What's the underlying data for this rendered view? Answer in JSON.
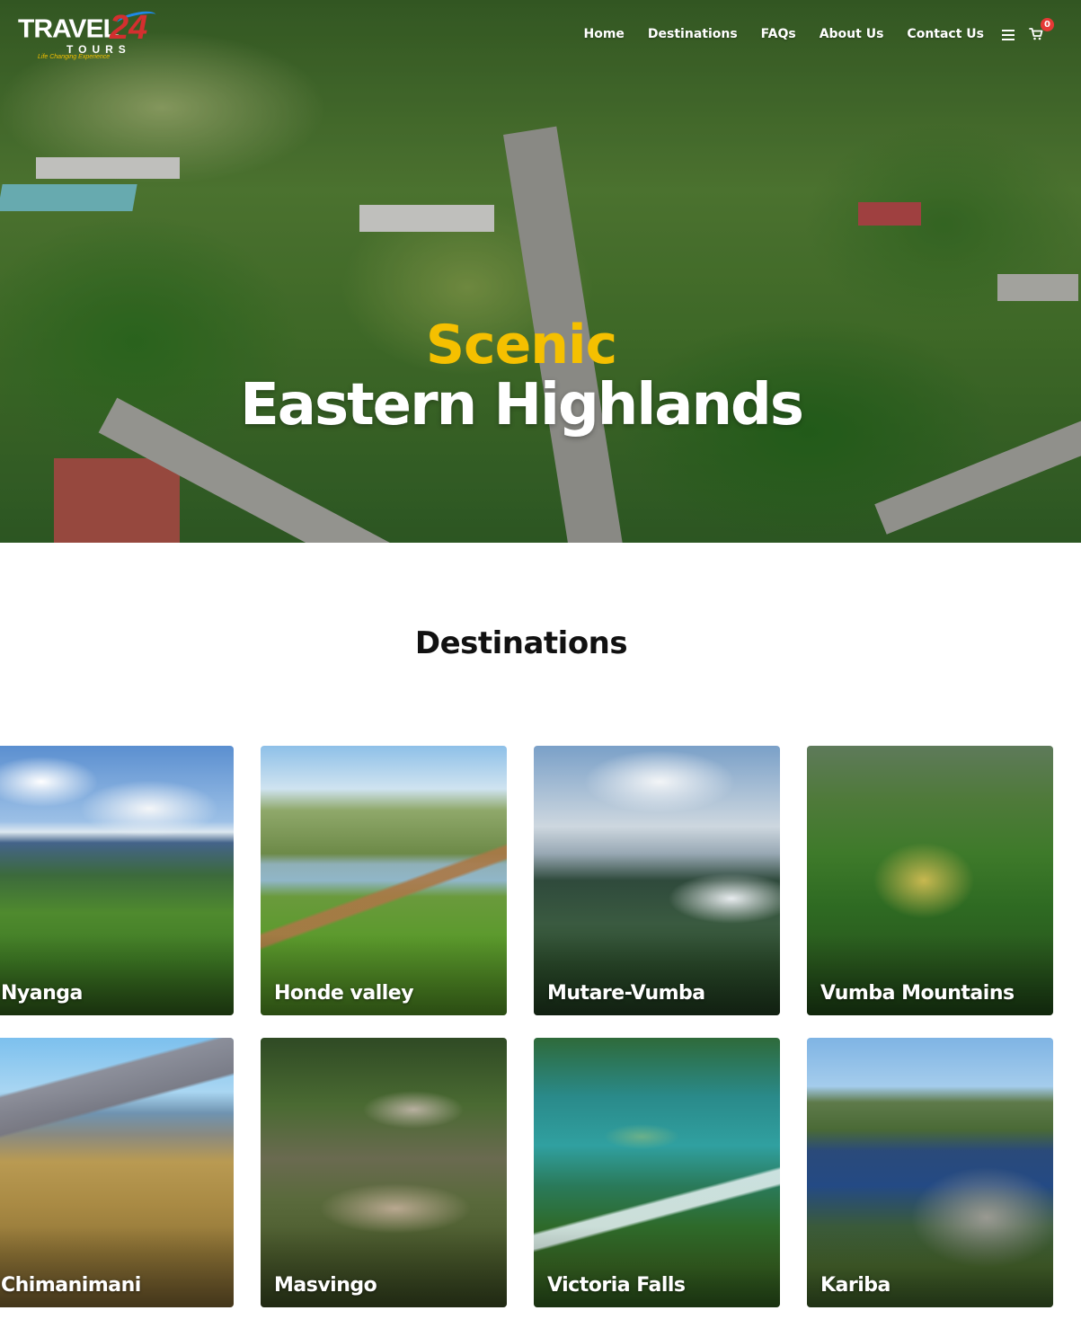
{
  "brand": {
    "logo_main": "TRAVEL",
    "logo_number": "24",
    "logo_sub": "TOURS",
    "logo_tagline": "Life Changing Experience"
  },
  "nav": {
    "items": [
      {
        "label": "Home"
      },
      {
        "label": "Destinations"
      },
      {
        "label": "FAQs"
      },
      {
        "label": "About Us"
      },
      {
        "label": "Contact Us"
      }
    ],
    "menu_icon": "hamburger-menu-icon",
    "cart_icon": "shopping-cart-icon",
    "cart_count": "0"
  },
  "hero": {
    "subtitle": "Scenic",
    "title": "Eastern Highlands"
  },
  "destinations": {
    "heading": "Destinations",
    "cards": [
      {
        "label": "Nyanga"
      },
      {
        "label": "Honde valley"
      },
      {
        "label": "Mutare-Vumba"
      },
      {
        "label": "Vumba Mountains"
      },
      {
        "label": "Chimanimani"
      },
      {
        "label": "Masvingo"
      },
      {
        "label": "Victoria Falls"
      },
      {
        "label": "Kariba"
      }
    ]
  },
  "colors": {
    "accent_yellow": "#f5c000",
    "badge_red": "#e53935",
    "heading_text": "#111111"
  }
}
